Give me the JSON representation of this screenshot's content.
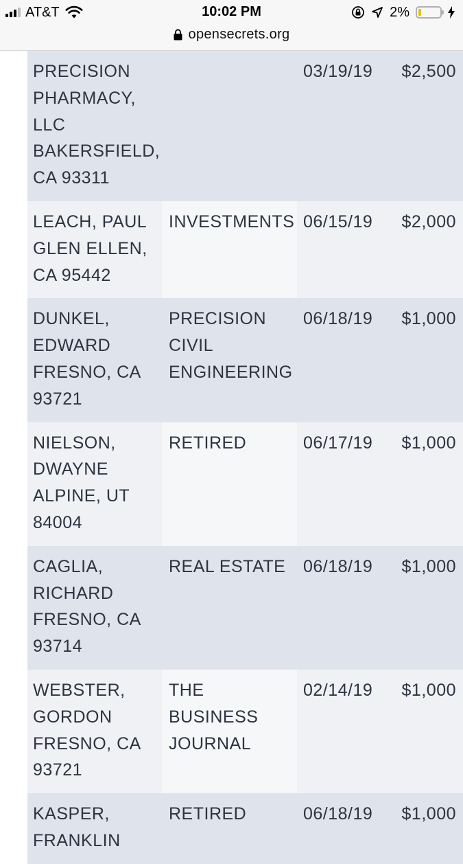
{
  "status_bar": {
    "carrier": "AT&T",
    "time": "10:02 PM",
    "battery": "2%",
    "battery_level": 0.02,
    "icons": [
      "signal-icon",
      "wifi-icon",
      "orientation-lock-icon",
      "location-icon",
      "battery-icon",
      "charging-icon"
    ]
  },
  "address_bar": {
    "url": "opensecrets.org",
    "icon": "lock-icon"
  },
  "contributions": [
    {
      "name": "PRECISION PHARMACY, LLC",
      "location": "BAKERSFIELD, CA 93311",
      "employer": "",
      "date": "03/19/19",
      "amount": "$2,500"
    },
    {
      "name": "LEACH, PAUL",
      "location": "GLEN ELLEN, CA 95442",
      "employer": "INVESTMENTS",
      "date": "06/15/19",
      "amount": "$2,000"
    },
    {
      "name": "DUNKEL, EDWARD",
      "location": "FRESNO, CA 93721",
      "employer": "PRECISION CIVIL ENGINEERING",
      "date": "06/18/19",
      "amount": "$1,000"
    },
    {
      "name": "NIELSON, DWAYNE",
      "location": "ALPINE, UT 84004",
      "employer": "RETIRED",
      "date": "06/17/19",
      "amount": "$1,000"
    },
    {
      "name": "CAGLIA, RICHARD",
      "location": "FRESNO, CA 93714",
      "employer": "REAL ESTATE",
      "date": "06/18/19",
      "amount": "$1,000"
    },
    {
      "name": "WEBSTER, GORDON",
      "location": "FRESNO, CA 93721",
      "employer": "THE BUSINESS JOURNAL",
      "date": "02/14/19",
      "amount": "$1,000"
    },
    {
      "name": "KASPER, FRANKLIN",
      "location": "",
      "employer": "RETIRED",
      "date": "06/18/19",
      "amount": "$1,000"
    }
  ]
}
